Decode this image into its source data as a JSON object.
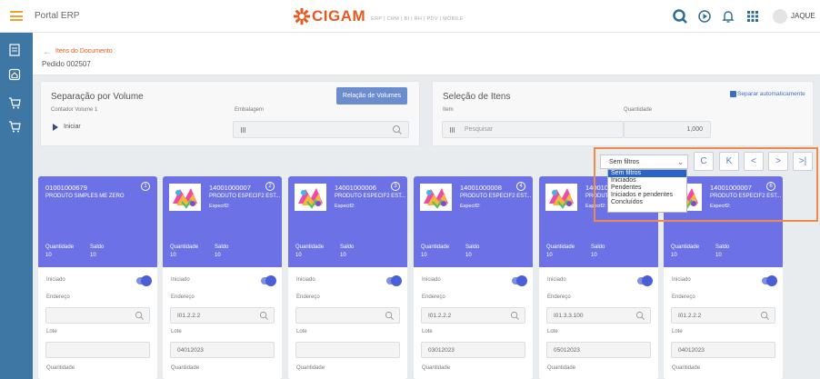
{
  "topbar": {
    "portal_title": "Portal ERP",
    "brand": "CIGAM",
    "brand_tagline": "ERP | CRM | BI | RH | PDV | MOBILE",
    "user": "JAQUE"
  },
  "breadcrumb": {
    "link": "Itens do Documento",
    "current": "Pedido 002507"
  },
  "volume": {
    "title": "Separação por Volume",
    "counter_label": "Contador Volume 1",
    "start_label": "Iniciar",
    "packaging_label": "Embalagem",
    "volumes_button": "Relação de Volumes"
  },
  "items_selection": {
    "title": "Seleção de Itens",
    "item_label": "Item",
    "search_placeholder": "Pesquisar",
    "quantity_label": "Quantidade",
    "quantity_value": "1,000",
    "auto_separate_label": "Separar automaticamente"
  },
  "filter": {
    "selected": "Sem filtros",
    "options": [
      "Sem filtros",
      "Iniciados",
      "Pendentes",
      "Iniciados e pendentes",
      "Concluídos"
    ]
  },
  "nav_buttons": [
    "C",
    "K",
    "<",
    ">",
    ">|"
  ],
  "card_labels": {
    "quantity": "Quantidade",
    "balance": "Saldo",
    "started": "Iniciado",
    "address": "Endereço",
    "lot": "Lote",
    "quantity_bottom": "Quantidade"
  },
  "cards": [
    {
      "code": "01001000679",
      "desc": "PRODUTO SIMPLES ME ZERO",
      "spec": "",
      "num": "1",
      "qty": "10",
      "balance": "10",
      "address": "",
      "lot": ""
    },
    {
      "code": "14001000007",
      "desc": "PRODUTO ESPECIF2 EST...",
      "spec": "Especif2:",
      "num": "2",
      "qty": "10",
      "balance": "10",
      "address": "I01.2.2.2",
      "lot": "04012023"
    },
    {
      "code": "14001000006",
      "desc": "PRODUTO ESPECIF2 EST...",
      "spec": "Especif2:",
      "num": "3",
      "qty": "10",
      "balance": "10",
      "address": "",
      "lot": ""
    },
    {
      "code": "14001000008",
      "desc": "PRODUTO ESPECIF2 EST...",
      "spec": "Especif2:",
      "num": "4",
      "qty": "10",
      "balance": "10",
      "address": "I01.2.2.2",
      "lot": "03012023"
    },
    {
      "code": "14001000008",
      "desc": "PRODUTO ESPECIF2 EST...",
      "spec": "Especif2:",
      "num": "5",
      "qty": "10",
      "balance": "10",
      "address": "I01.3.3.100",
      "lot": "05012023"
    },
    {
      "code": "14001000007",
      "desc": "PRODUTO ESPECIF2 EST...",
      "spec": "Especif2:",
      "num": "6",
      "qty": "10",
      "balance": "10",
      "address": "I01.2.2.2",
      "lot": "04012023"
    }
  ],
  "colors": {
    "accent": "#e65a1e",
    "sidebar": "#3e77a3",
    "card_header": "#6c72e6",
    "highlight_box": "#f0894a"
  }
}
